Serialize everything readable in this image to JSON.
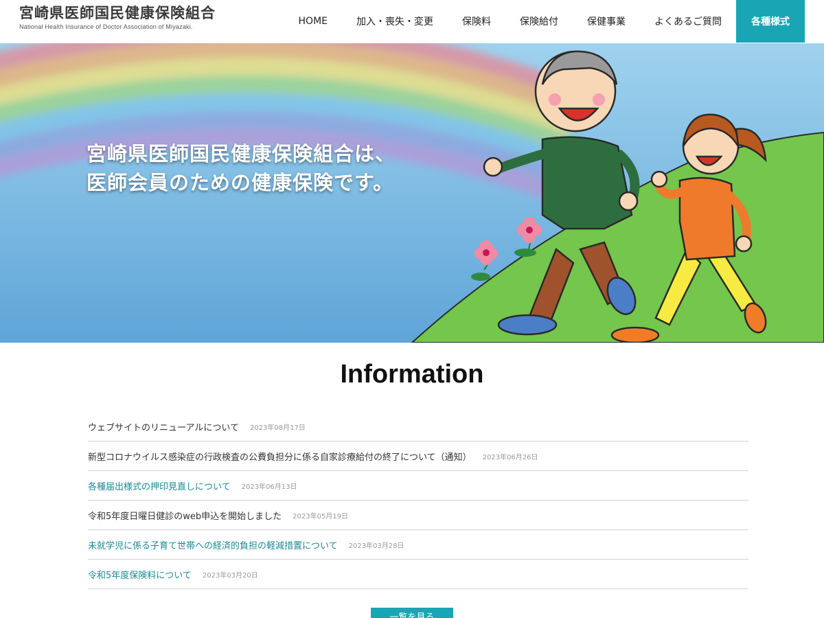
{
  "site": {
    "title": "宮崎県医師国民健康保険組合",
    "subtitle": "National Health Insurance of Doctor Association of Miyazaki."
  },
  "nav": {
    "items": [
      "HOME",
      "加入・喪失・変更",
      "保険料",
      "保険給付",
      "保健事業",
      "よくあるご質問"
    ],
    "accent_label": "各種様式",
    "accent_color": "#1aa5b4"
  },
  "hero": {
    "line1": "宮崎県医師国民健康保険組合は、",
    "line2": "医師会員のための健康保険です。"
  },
  "info": {
    "title": "Information",
    "items": [
      {
        "text": "ウェブサイトのリニューアルについて",
        "date": "2023年08月17日"
      },
      {
        "text": "新型コロナウイルス感染症の行政検査の公費負担分に係る自家診療給付の終了について（通知）",
        "date": "2023年06月26日"
      },
      {
        "text": "各種届出様式の押印見直しについて",
        "date": "2023年06月13日"
      },
      {
        "text": "令和5年度日曜日健診のweb申込を開始しました",
        "date": "2023年05月19日"
      },
      {
        "text": "未就学児に係る子育て世帯への経済的負担の軽減措置について",
        "date": "2023年03月28日"
      },
      {
        "text": "令和5年度保険料について",
        "date": "2023年03月20日"
      }
    ],
    "more_label": "一覧を見る"
  }
}
